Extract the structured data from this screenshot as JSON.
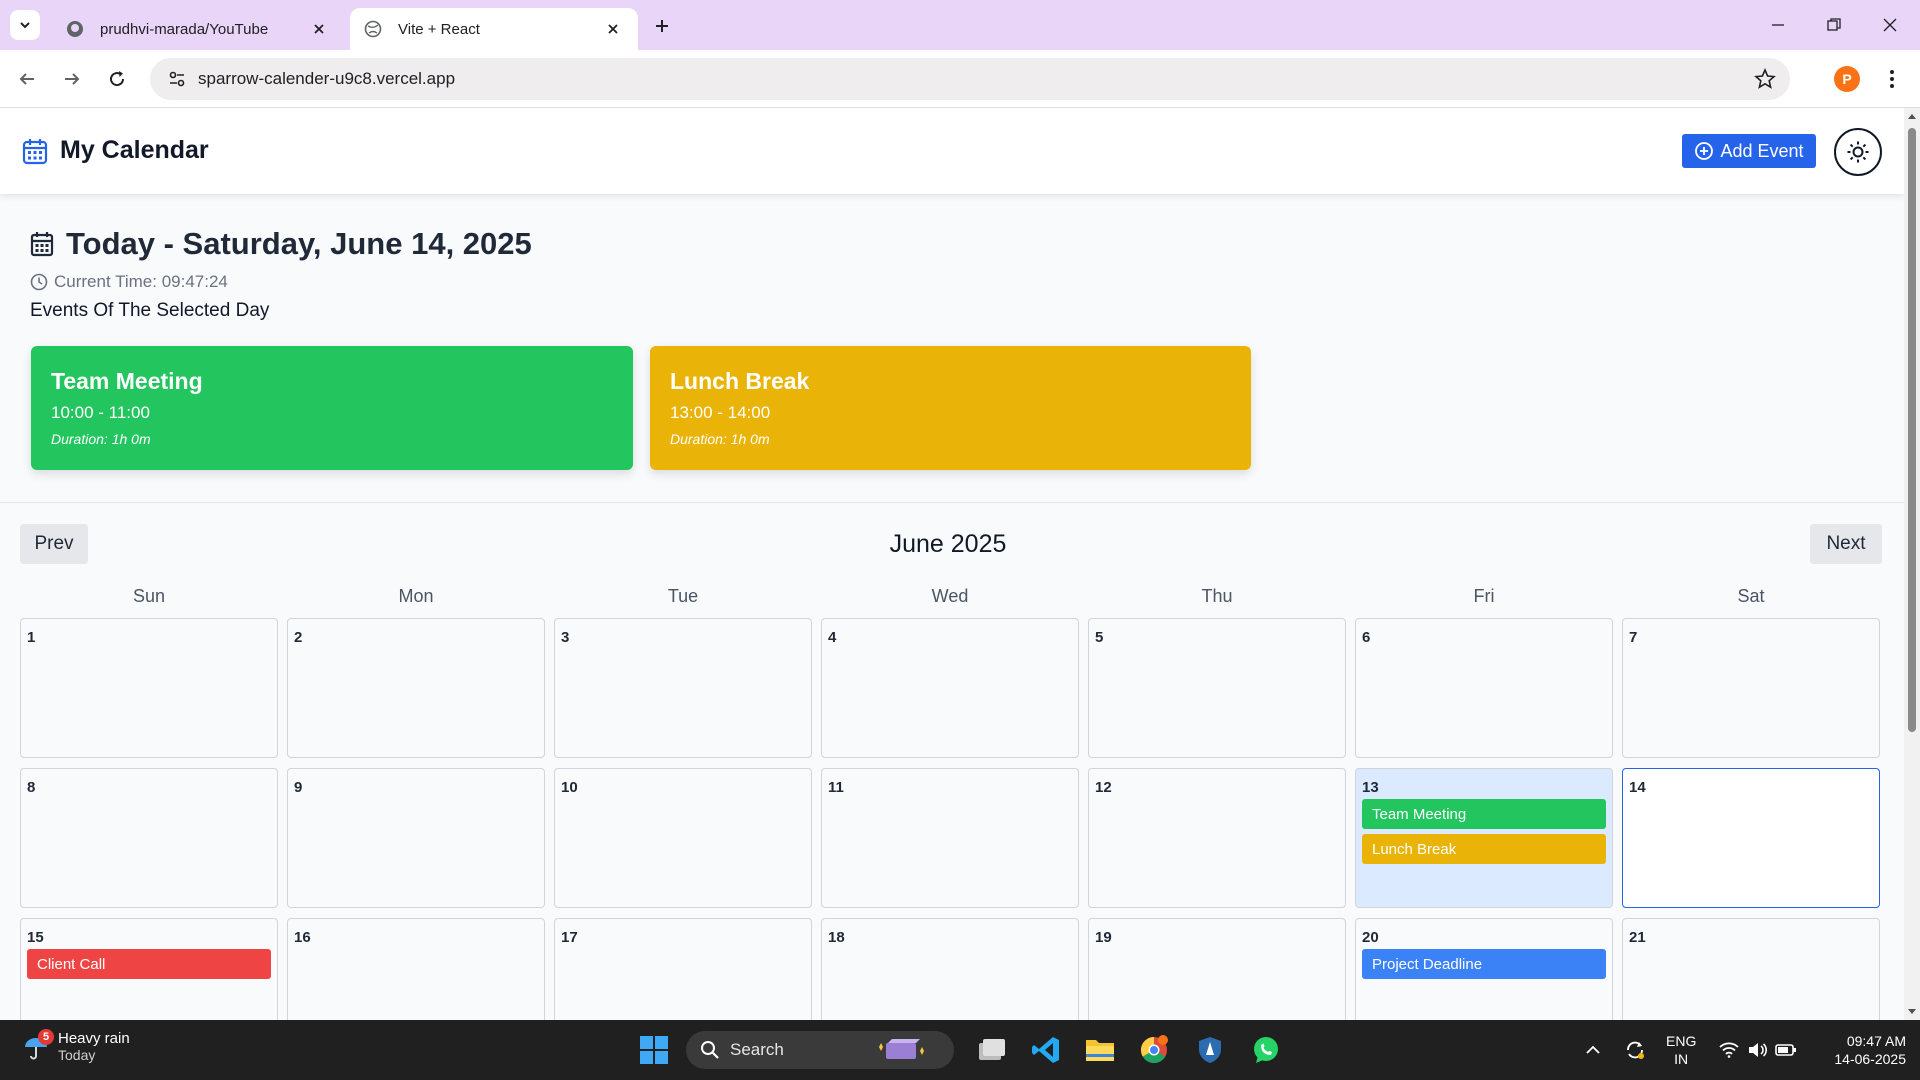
{
  "browser": {
    "tabs": [
      {
        "title": "prudhvi-marada/YouTube",
        "favicon": "github-icon",
        "active": false
      },
      {
        "title": "Vite + React",
        "favicon": "globe-icon",
        "active": true
      }
    ],
    "url": "sparrow-calender-u9c8.vercel.app",
    "profile_initial": "P"
  },
  "header": {
    "title": "My Calendar",
    "add_event_label": "Add Event",
    "theme_icon": "sun-icon"
  },
  "today": {
    "heading": "Today - Saturday, June 14, 2025",
    "current_time": "Current Time: 09:47:24",
    "events_label": "Events Of The Selected Day",
    "events": [
      {
        "title": "Team Meeting",
        "time": "10:00 - 11:00",
        "duration": "Duration: 1h 0m",
        "color": "#22c55e"
      },
      {
        "title": "Lunch Break",
        "time": "13:00 - 14:00",
        "duration": "Duration: 1h 0m",
        "color": "#eab308"
      }
    ]
  },
  "calendar": {
    "month_title": "June 2025",
    "prev_label": "Prev",
    "next_label": "Next",
    "weekdays": [
      "Sun",
      "Mon",
      "Tue",
      "Wed",
      "Thu",
      "Fri",
      "Sat"
    ],
    "weeks": [
      [
        {
          "day": "1",
          "events": []
        },
        {
          "day": "2",
          "events": []
        },
        {
          "day": "3",
          "events": []
        },
        {
          "day": "4",
          "events": []
        },
        {
          "day": "5",
          "events": []
        },
        {
          "day": "6",
          "events": []
        },
        {
          "day": "7",
          "events": []
        }
      ],
      [
        {
          "day": "8",
          "events": []
        },
        {
          "day": "9",
          "events": []
        },
        {
          "day": "10",
          "events": []
        },
        {
          "day": "11",
          "events": []
        },
        {
          "day": "12",
          "events": []
        },
        {
          "day": "13",
          "state": "highlight",
          "events": [
            {
              "title": "Team Meeting",
              "color": "#22c55e"
            },
            {
              "title": "Lunch Break",
              "color": "#eab308"
            }
          ]
        },
        {
          "day": "14",
          "state": "selected",
          "events": []
        }
      ],
      [
        {
          "day": "15",
          "events": [
            {
              "title": "Client Call",
              "color": "#ef4444"
            }
          ]
        },
        {
          "day": "16",
          "events": []
        },
        {
          "day": "17",
          "events": []
        },
        {
          "day": "18",
          "events": []
        },
        {
          "day": "19",
          "events": []
        },
        {
          "day": "20",
          "events": [
            {
              "title": "Project Deadline",
              "color": "#3b82f6"
            }
          ]
        },
        {
          "day": "21",
          "events": []
        }
      ]
    ]
  },
  "taskbar": {
    "weather": {
      "title": "Heavy rain",
      "subtitle": "Today",
      "badge": "5"
    },
    "search_label": "Search",
    "lang_line1": "ENG",
    "lang_line2": "IN",
    "time": "09:47 AM",
    "date": "14-06-2025"
  },
  "colors": {
    "accent": "#2563eb",
    "tab_strip": "#e9d5f7"
  }
}
